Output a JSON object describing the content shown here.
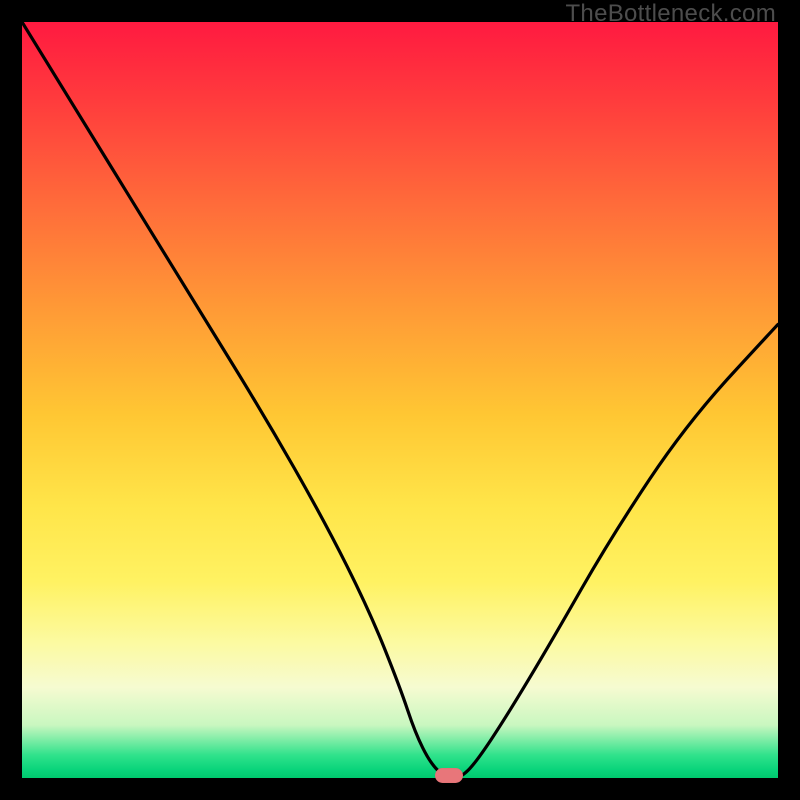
{
  "watermark": "TheBottleneck.com",
  "colors": {
    "gradient_top": "#ff1a40",
    "gradient_bottom": "#00c96e",
    "curve": "#000000",
    "marker": "#e8767a",
    "frame": "#000000"
  },
  "chart_data": {
    "type": "line",
    "title": "",
    "xlabel": "",
    "ylabel": "",
    "xlim": [
      0,
      100
    ],
    "ylim": [
      0,
      100
    ],
    "grid": false,
    "legend": false,
    "series": [
      {
        "name": "bottleneck-curve",
        "x": [
          0,
          8,
          16,
          24,
          32,
          40,
          46,
          50,
          52,
          54,
          56,
          58,
          60,
          64,
          70,
          78,
          88,
          100
        ],
        "y": [
          100,
          87,
          74,
          61,
          48,
          34,
          22,
          12,
          6,
          2,
          0,
          0,
          2,
          8,
          18,
          32,
          47,
          60
        ]
      }
    ],
    "annotations": [
      {
        "name": "optimum-marker",
        "x": 56.5,
        "y": 0
      }
    ]
  }
}
